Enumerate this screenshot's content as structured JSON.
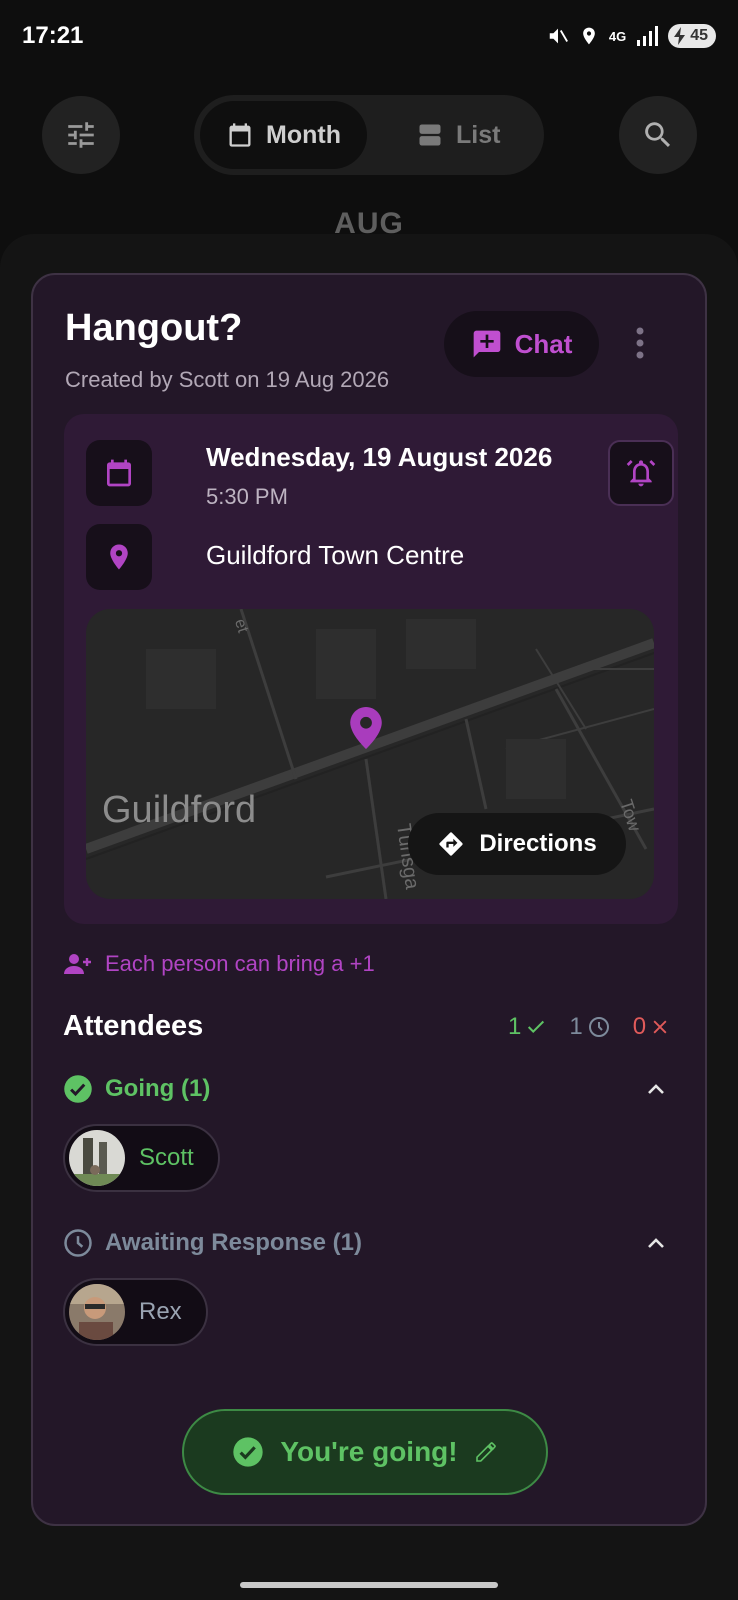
{
  "status": {
    "time": "17:21",
    "network": "4G",
    "battery": "45"
  },
  "toolbar": {
    "filter_icon": "tune-icon",
    "view_tabs": [
      {
        "label": "Month",
        "icon": "calendar-icon",
        "selected": true
      },
      {
        "label": "List",
        "icon": "list-icon",
        "selected": false
      }
    ],
    "search_icon": "search-icon"
  },
  "background": {
    "month_label": "AUG"
  },
  "event": {
    "title": "Hangout?",
    "subtitle": "Created by Scott on 19 Aug 2026",
    "chat_label": "Chat",
    "date": "Wednesday, 19 August 2026",
    "time": "5:30 PM",
    "location": "Guildford Town Centre",
    "map": {
      "city_label": "Guildford",
      "street_labels": [
        "et",
        "Tunsga",
        "Tow"
      ],
      "directions_label": "Directions"
    },
    "plus_one_text": "Each person can bring a +1",
    "attendees_title": "Attendees",
    "counts": {
      "going": "1",
      "pending": "1",
      "declined": "0"
    },
    "groups": [
      {
        "label": "Going (1)",
        "color": "#5ec264",
        "people": [
          {
            "name": "Scott"
          }
        ]
      },
      {
        "label": "Awaiting Response (1)",
        "color": "#7d8a9b",
        "people": [
          {
            "name": "Rex"
          }
        ]
      }
    ],
    "rsvp_label": "You're going!"
  },
  "colors": {
    "accent": "#c04fd0",
    "going": "#5ec264",
    "pending": "#7d8a9b",
    "declined": "#e05a5a",
    "card_bg": "#231728"
  }
}
